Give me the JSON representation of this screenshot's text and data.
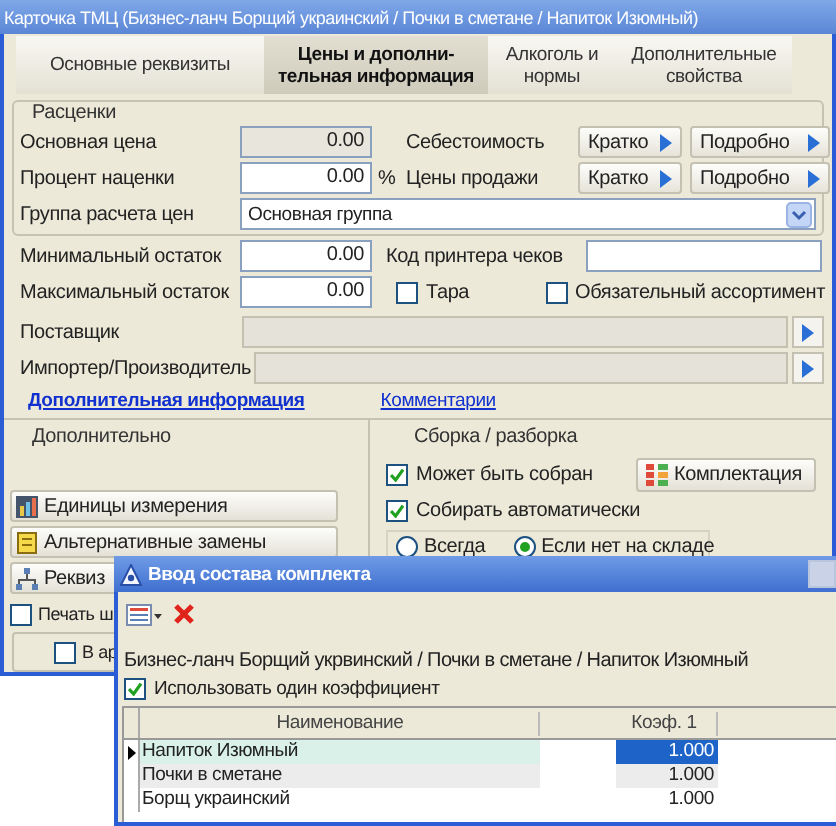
{
  "window": {
    "title": "Карточка ТМЦ (Бизнес-ланч Борщий украинский / Почки в сметане / Напиток Изюмный)"
  },
  "tabs": [
    {
      "label": "Основные реквизиты",
      "selected": false
    },
    {
      "label": "Цены и дополни-\nтельная информация",
      "selected": true
    },
    {
      "label": "Алкоголь и\nнормы",
      "selected": false
    },
    {
      "label": "Дополнительные\nсвойства",
      "selected": false
    }
  ],
  "pricing": {
    "legend": "Расценки",
    "rows": [
      {
        "label": "Основная цена",
        "value": "0.00",
        "readonly": true,
        "right_label": "Себестоимость",
        "buttons": [
          "Кратко",
          "Подробно"
        ]
      },
      {
        "label": "Процент наценки",
        "value": "0.00",
        "readonly": false,
        "unit": "%",
        "right_label": "Цены продажи",
        "buttons": [
          "Кратко",
          "Подробно"
        ]
      }
    ],
    "group": {
      "label": "Группа расчета цен",
      "value": "Основная группа"
    }
  },
  "stock": [
    {
      "label": "Минимальный остаток",
      "value": "0.00",
      "kind": "field",
      "extra_label": "Код принтера чеков"
    },
    {
      "label": "Максимальный остаток",
      "value": "0.00",
      "kind": "checks",
      "checks": [
        {
          "label": "Тара",
          "checked": false
        },
        {
          "label": "Обязательный ассортимент",
          "checked": false
        }
      ]
    }
  ],
  "parties": [
    {
      "label": "Поставщик"
    },
    {
      "label": "Импортер/Производитель"
    }
  ],
  "links": [
    {
      "label": "Дополнительная информация",
      "selected": true
    },
    {
      "label": "Комментарии",
      "selected": false
    }
  ],
  "extra": {
    "legend": "Дополнительно",
    "buttons": [
      {
        "label": "Единицы измерения",
        "kind": "chart"
      },
      {
        "label": "Альтернативные замены",
        "kind": "note"
      },
      {
        "label": "Реквиз",
        "kind": "tree"
      }
    ],
    "print": {
      "label": "Печать ш",
      "checked": false
    },
    "archive": {
      "label": "В ар",
      "checked": false
    }
  },
  "assembly": {
    "legend": "Сборка / разборка",
    "options": [
      {
        "label": "Может быть собран",
        "checked": true
      },
      {
        "label": "Собирать автоматически",
        "checked": true
      }
    ],
    "button": "Комплектация",
    "radios": [
      {
        "label": "Всегда",
        "selected": false
      },
      {
        "label": "Если нет на складе",
        "selected": true
      }
    ]
  },
  "dialog": {
    "title": "Ввод состава комплекта",
    "heading": "Бизнес-ланч Борщий укрвинский / Почки в сметане / Напиток Изюмный",
    "option": {
      "label": "Использовать один коэффициент",
      "checked": true
    },
    "columns": [
      "Наименование",
      "Коэф. 1"
    ],
    "rows": [
      {
        "name": "Напиток Изюмный",
        "coef": "1.000",
        "selected": true
      },
      {
        "name": "Почки в сметане",
        "coef": "1.000",
        "selected": false
      },
      {
        "name": "Борщ украинский",
        "coef": "1.000",
        "selected": false
      }
    ]
  }
}
